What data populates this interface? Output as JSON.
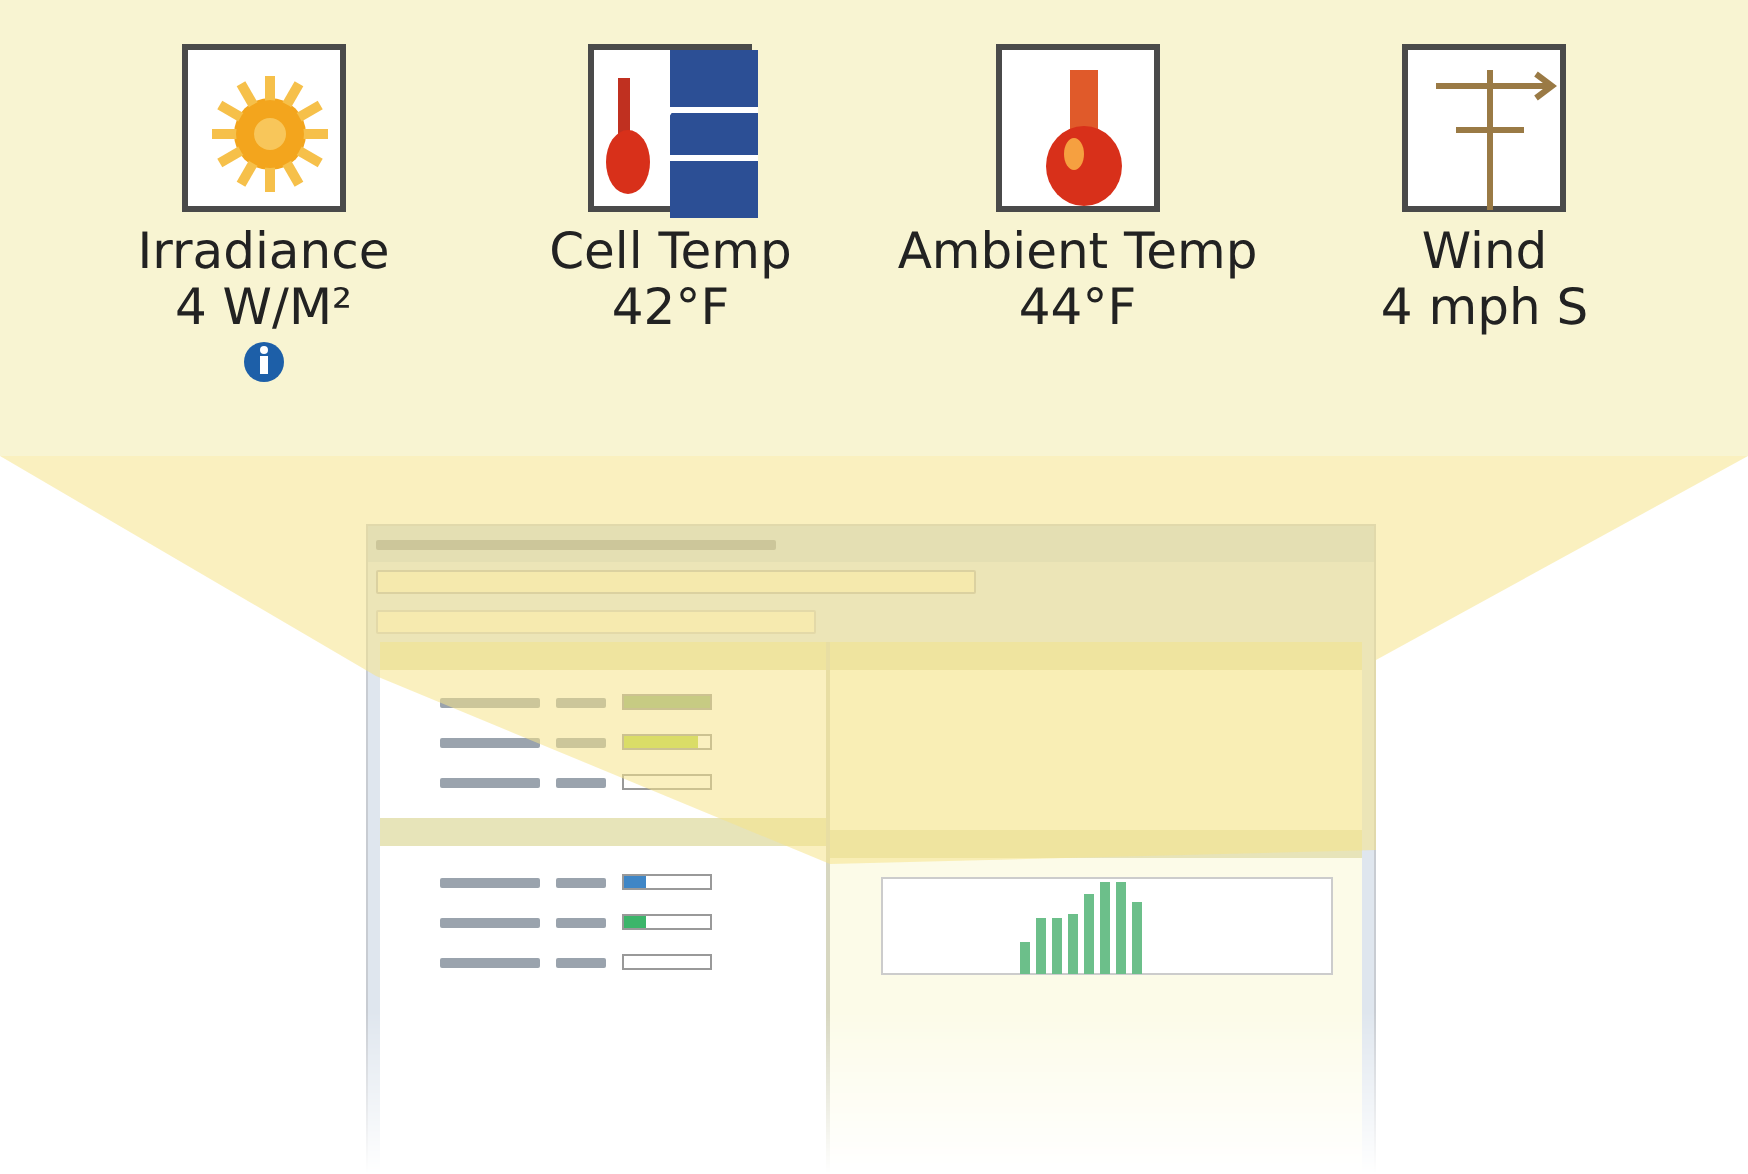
{
  "callout": {
    "items": [
      {
        "kind": "irradiance",
        "label": "Irradiance",
        "value": "4 W/M²",
        "info": true
      },
      {
        "kind": "cell",
        "label": "Cell Temp",
        "value": "42°F"
      },
      {
        "kind": "ambient",
        "label": "Ambient Temp",
        "value": "44°F"
      },
      {
        "kind": "wind",
        "label": "Wind",
        "value": "4 mph S"
      }
    ]
  },
  "screenshot": {
    "top_meters": [
      {
        "level": 1
      },
      {
        "level": 0.85
      },
      {
        "level": 0
      }
    ],
    "bottom_meters": [
      {
        "level": 0.25
      },
      {
        "level": 0.25
      },
      {
        "level": 0
      }
    ]
  }
}
